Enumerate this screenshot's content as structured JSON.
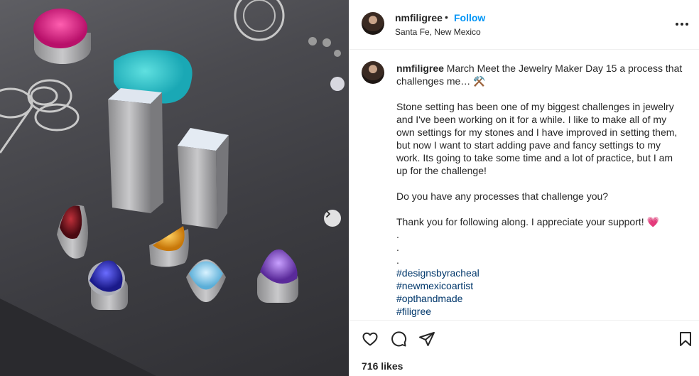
{
  "post": {
    "username": "nmfiligree",
    "separator": "•",
    "follow_label": "Follow",
    "location": "Santa Fe, New Mexico",
    "more_icon": "more-horizontal-icon"
  },
  "caption": {
    "username": "nmfiligree",
    "first_line": "March Meet the Jewelry Maker Day 15 a process that challenges me…",
    "first_line_emoji": "⚒️",
    "paragraph_1": "Stone setting has been one of my biggest challenges in jewelry and I've been working on it for a while. I like to make all of my own settings for my stones and I have improved in setting them, but now I want to start adding pave and fancy settings to my work. Its going to take some time and a lot of practice, but I am up for the challenge!",
    "paragraph_2": "Do you have any processes that challenge you?",
    "paragraph_3": "Thank you for following along. I appreciate your support!",
    "paragraph_3_emoji": "💗",
    "dots": [
      ".",
      ".",
      "."
    ],
    "hashtags": [
      "#designsbyracheal",
      "#newmexicoartist",
      "#opthandmade",
      "#filigree"
    ]
  },
  "actions": {
    "like_icon": "heart-icon",
    "comment_icon": "comment-icon",
    "share_icon": "share-icon",
    "save_icon": "bookmark-icon"
  },
  "likes": "716 likes",
  "colors": {
    "link_blue": "#0095f6",
    "hashtag": "#00376b",
    "text": "#262626",
    "border": "#efefef"
  }
}
